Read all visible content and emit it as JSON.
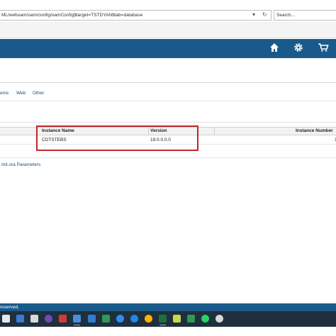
{
  "browser": {
    "url": "ML/weboam/oam/config/oamConfig$target=TSTDYAN$tab=database",
    "search_placeholder": "Search..."
  },
  "header": {
    "home_icon": "home-icon",
    "settings_icon": "gear-icon",
    "cart_icon": "cart-icon"
  },
  "tabs": [
    {
      "label": "ems"
    },
    {
      "label": "Web"
    },
    {
      "label": "Other"
    }
  ],
  "table": {
    "columns": [
      "Instance Name",
      "Version",
      "Instance Number"
    ],
    "rows": [
      {
        "instance_name": "CDTSTEBS",
        "version": "19.0.0.0.0",
        "instance_number": "1"
      }
    ]
  },
  "links": {
    "init_params": "Init.ora Parameters"
  },
  "footer": {
    "copyright": "reserved."
  },
  "colors": {
    "header": "#1a5a8a",
    "highlight": "#c0272d",
    "link": "#1a4d7a"
  }
}
